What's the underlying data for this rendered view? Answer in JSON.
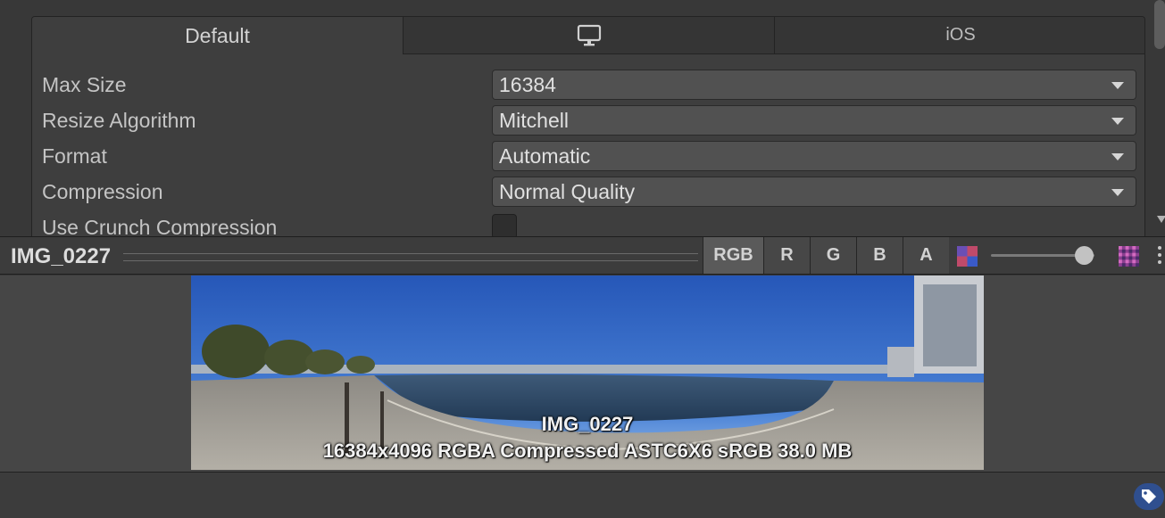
{
  "platform_tabs": {
    "default_label": "Default",
    "ios_label": "iOS",
    "standalone_icon": "monitor-icon"
  },
  "settings": {
    "max_size": {
      "label": "Max Size",
      "value": "16384"
    },
    "resize_algorithm": {
      "label": "Resize Algorithm",
      "value": "Mitchell"
    },
    "format": {
      "label": "Format",
      "value": "Automatic"
    },
    "compression": {
      "label": "Compression",
      "value": "Normal Quality"
    },
    "crunch": {
      "label": "Use Crunch Compression",
      "checked": false
    }
  },
  "preview": {
    "title": "IMG_0227",
    "channels": [
      "RGB",
      "R",
      "G",
      "B",
      "A"
    ],
    "active_channel": "RGB",
    "mip_level_fraction": 0.9,
    "image_name": "IMG_0227",
    "image_info": "16384x4096  RGBA Compressed ASTC6X6 sRGB   38.0 MB"
  },
  "footer": {
    "label_icon": "tag-icon"
  },
  "colors": {
    "panel_bg": "#3e3e3e",
    "dropdown_bg": "#515151",
    "active_channel_bg": "#5a5a5a",
    "label_badge": "#2f4f8f"
  }
}
